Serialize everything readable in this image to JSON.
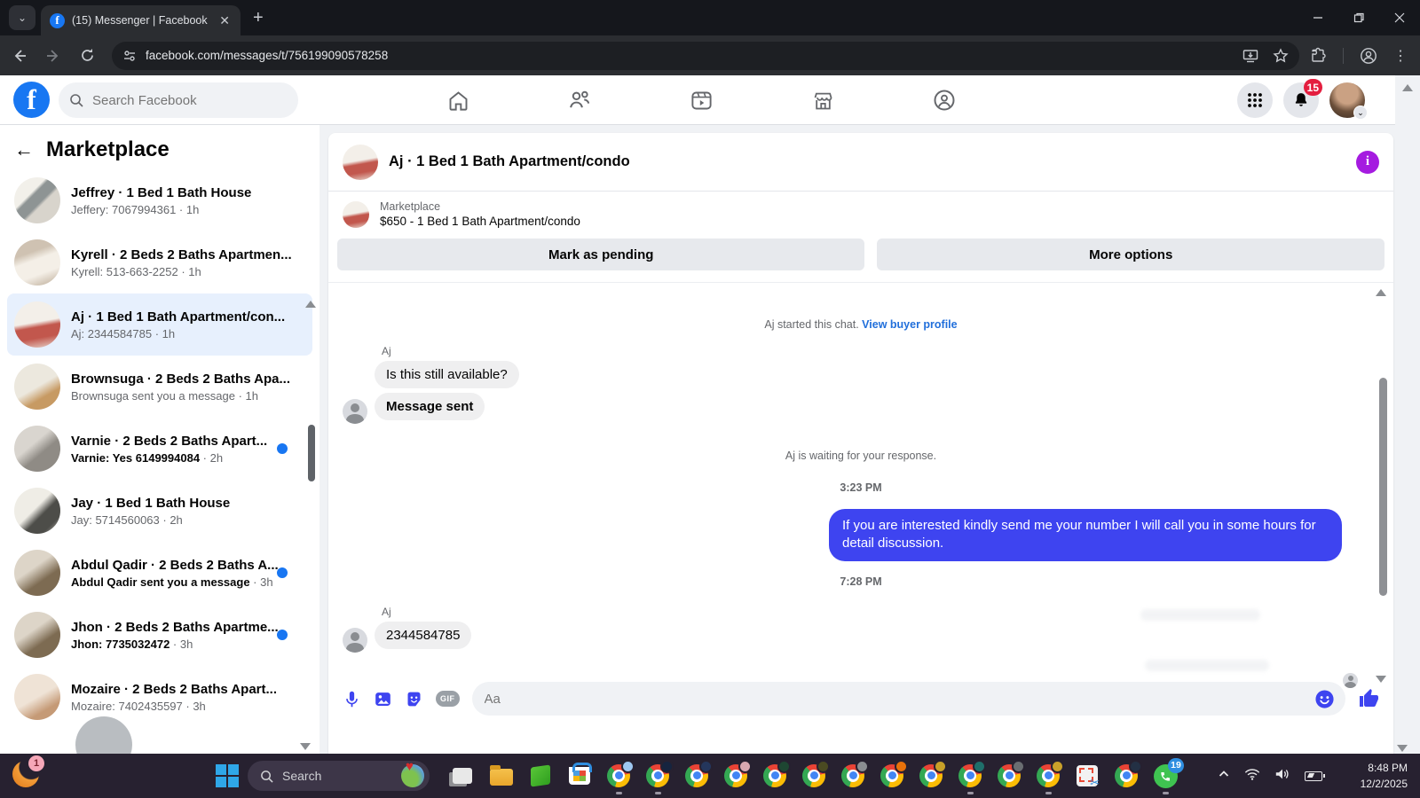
{
  "browser": {
    "tab_title": "(15) Messenger | Facebook",
    "url": "facebook.com/messages/t/756199090578258"
  },
  "fb_header": {
    "search_placeholder": "Search Facebook",
    "notification_badge": "15",
    "nav_items": [
      "home",
      "friends",
      "watch",
      "marketplace",
      "groups"
    ]
  },
  "sidebar": {
    "title": "Marketplace",
    "items": [
      {
        "title": "Jeffrey · 1 Bed 1 Bath House",
        "preview": "Jeffery: 7067994361",
        "time": "1h",
        "bold": false,
        "unread": false,
        "selected": false,
        "avatar": "av-kitchen1"
      },
      {
        "title": "Kyrell · 2 Beds 2 Baths Apartmen...",
        "preview": "Kyrell: 513-663-2252",
        "time": "1h",
        "bold": false,
        "unread": false,
        "selected": false,
        "avatar": "av-bedroom1"
      },
      {
        "title": "Aj · 1 Bed 1 Bath Apartment/con...",
        "preview": "Aj: 2344584785",
        "time": "1h",
        "bold": false,
        "unread": false,
        "selected": true,
        "avatar": "av-bedroom2"
      },
      {
        "title": "Brownsuga · 2 Beds 2 Baths Apa...",
        "preview": "Brownsuga sent you a message",
        "time": "1h",
        "bold": false,
        "unread": false,
        "selected": false,
        "avatar": "av-kitchen2"
      },
      {
        "title": "Varnie · 2 Beds 2 Baths Apart...",
        "preview": "Varnie: Yes 6149994084",
        "time": "2h",
        "bold": true,
        "unread": true,
        "selected": false,
        "avatar": "av-living1"
      },
      {
        "title": "Jay · 1 Bed 1 Bath House",
        "preview": "Jay: 5714560063",
        "time": "2h",
        "bold": false,
        "unread": false,
        "selected": false,
        "avatar": "av-kitchen3"
      },
      {
        "title": "Abdul Qadir · 2 Beds 2 Baths A...",
        "preview": "Abdul Qadir sent you a message",
        "time": "3h",
        "bold": true,
        "unread": true,
        "selected": false,
        "avatar": "av-dining1"
      },
      {
        "title": "Jhon · 2 Beds 2 Baths Apartme...",
        "preview": "Jhon: 7735032472",
        "time": "3h",
        "bold": true,
        "unread": true,
        "selected": false,
        "avatar": "av-dining1"
      },
      {
        "title": "Mozaire · 2 Beds 2 Baths Apart...",
        "preview": "Mozaire: 7402435597",
        "time": "3h",
        "bold": false,
        "unread": false,
        "selected": false,
        "avatar": "av-living2"
      }
    ]
  },
  "chat": {
    "title": "Aj · 1 Bed 1 Bath Apartment/condo",
    "listing_label": "Marketplace",
    "listing_detail": "$650 - 1 Bed 1 Bath Apartment/condo",
    "mark_pending_label": "Mark as pending",
    "more_options_label": "More options",
    "system_text": "Aj started this chat. ",
    "system_link": "View buyer profile",
    "sender_label": "Aj",
    "messages": {
      "m1": "Is this still available?",
      "m2": "Message sent",
      "m3": "If you are interested kindly send me your number I will call you in some hours for detail discussion.",
      "m4": "2344584785"
    },
    "waiting_text": "Aj is waiting for your response.",
    "timestamp1": "3:23 PM",
    "timestamp2": "7:28 PM",
    "composer_placeholder": "Aa",
    "gif_label": "GIF",
    "bubble_color": "#3e44f0",
    "info_icon_color": "#a51be0"
  },
  "taskbar": {
    "search_placeholder": "Search",
    "left_icon_badge": "1",
    "whatsapp_badge": "19",
    "time": "8:48 PM",
    "date": "12/2/2025",
    "chrome_badges": [
      {
        "color": "#9ec7f0",
        "dot": true
      },
      {
        "color": "#16243f",
        "dot": true
      },
      {
        "color": "#24365c",
        "dot": false
      },
      {
        "color": "#d8a8b0",
        "dot": false
      },
      {
        "color": "#1e4632",
        "dot": false
      },
      {
        "color": "#4a4a22",
        "dot": false
      },
      {
        "color": "#8a8d91",
        "dot": false
      },
      {
        "color": "#e8710a",
        "dot": false
      },
      {
        "color": "#c8a028",
        "dot": false
      },
      {
        "color": "#1f6e6a",
        "dot": true
      },
      {
        "color": "#6a6d71",
        "dot": false
      },
      {
        "color": "#caa12a",
        "dot": true
      }
    ]
  }
}
